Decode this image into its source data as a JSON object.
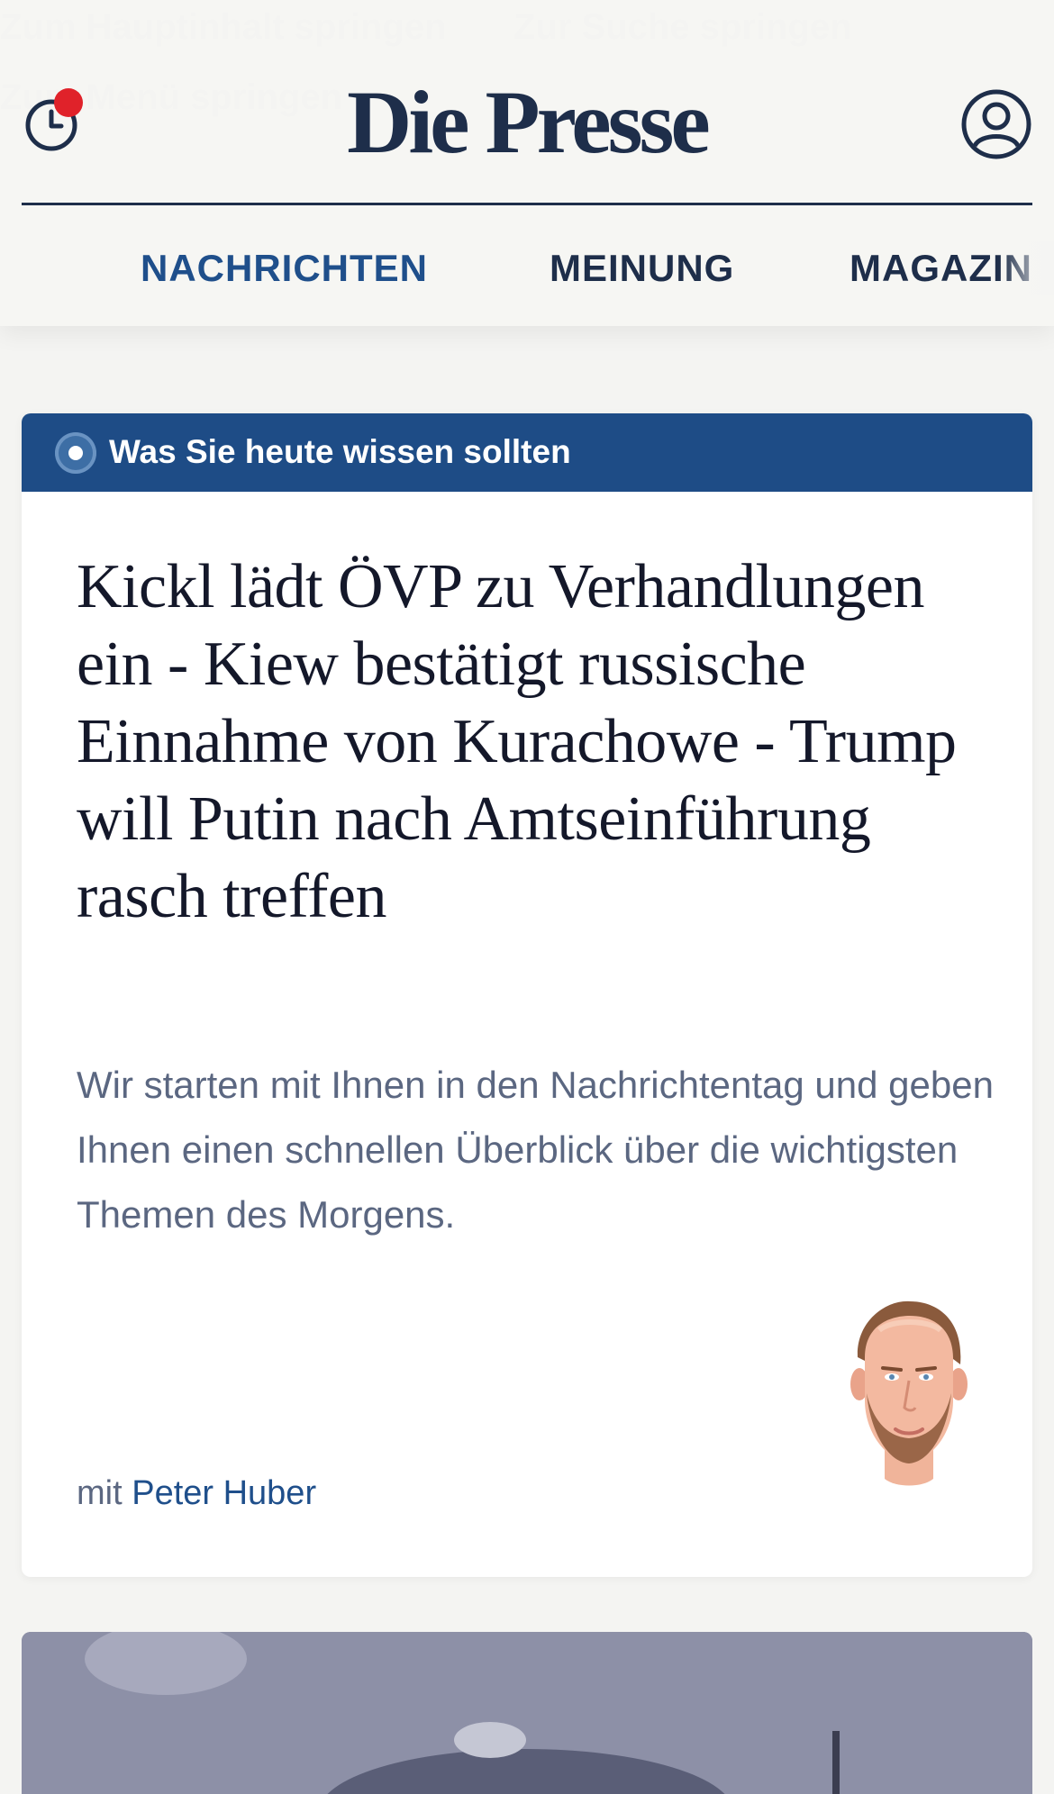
{
  "skip_links": [
    "Zum Hauptinhalt springen",
    "Zur Suche springen",
    "Zum Menü springen"
  ],
  "header": {
    "logo": "Die Presse",
    "history_icon": "clock-history-icon",
    "notification_color": "#e0222a",
    "account_icon": "user-account-icon"
  },
  "nav": {
    "menu_icon": "hamburger-menu-icon",
    "items": [
      {
        "label": "NACHRICHTEN",
        "active": true
      },
      {
        "label": "MEINUNG",
        "active": false
      },
      {
        "label": "MAGAZIN",
        "active": false
      }
    ]
  },
  "briefing": {
    "label": "Was Sie heute wissen sollten",
    "headline": "Kickl lädt ÖVP zu Verhandlungen ein - Kiew bestätigt russische Einnahme von Kurachowe - Trump will Putin nach Amtseinführung rasch treffen",
    "lead": "Wir starten mit Ihnen in den Nachrichtentag und geben Ihnen einen schnellen Überblick über die wichtigsten Themen des Morgens.",
    "byline_prefix": "mit",
    "author": "Peter Huber",
    "avatar_icon": "author-illustration"
  },
  "colors": {
    "brand_navy": "#1e2e4a",
    "accent_blue": "#1f4f8b",
    "banner_blue": "#1e4c86",
    "page_bg": "#f4f4f2"
  }
}
